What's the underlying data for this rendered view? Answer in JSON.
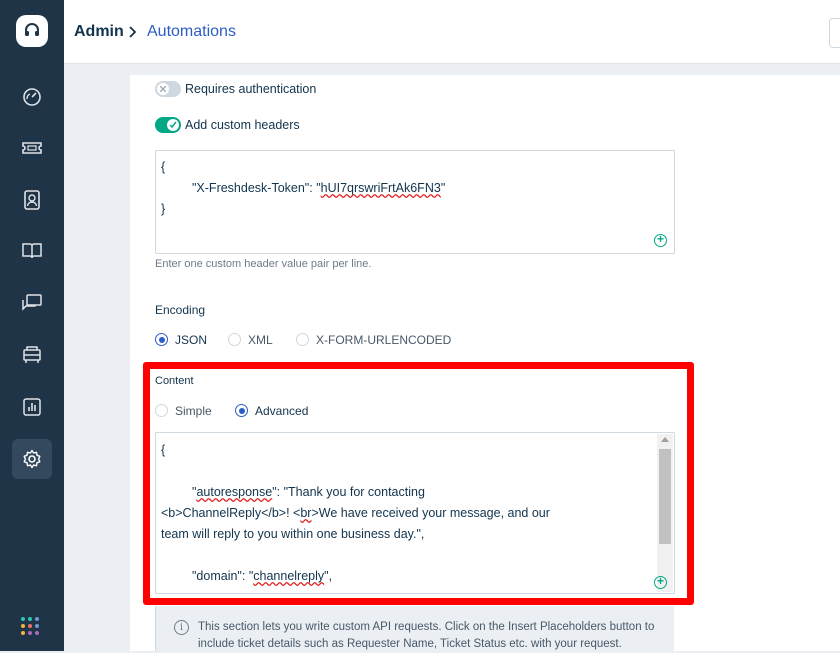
{
  "sidebar": {
    "logo_icon": "headset-icon",
    "items": [
      {
        "icon": "dashboard-icon"
      },
      {
        "icon": "ticket-icon"
      },
      {
        "icon": "contacts-icon"
      },
      {
        "icon": "solutions-book-icon"
      },
      {
        "icon": "discussions-icon"
      },
      {
        "icon": "assets-icon"
      },
      {
        "icon": "reports-icon"
      },
      {
        "icon": "gear-icon",
        "active": true
      }
    ],
    "apps_icon": "apps-grid-icon"
  },
  "breadcrumb": {
    "root": "Admin",
    "current": "Automations"
  },
  "auth": {
    "requires_auth_label": "Requires authentication",
    "requires_auth_on": false,
    "custom_headers_label": "Add custom headers",
    "custom_headers_on": true
  },
  "headers_box": {
    "line1": "{",
    "line2_key": "\"X-Freshdesk-Token\": \"",
    "line2_token": "hUI7qrswriFrtAk6FN3",
    "line2_end": "\"",
    "line3": "}",
    "hint": "Enter one custom header value pair per line."
  },
  "encoding": {
    "label": "Encoding",
    "options": [
      "JSON",
      "XML",
      "X-FORM-URLENCODED"
    ],
    "selected": "JSON"
  },
  "content": {
    "label": "Content",
    "modes": [
      "Simple",
      "Advanced"
    ],
    "selected": "Advanced",
    "code": {
      "open": "{",
      "l1_a": "\"",
      "l1_key": "autoresponse",
      "l1_b": "\": \"Thank you for contacting",
      "l2_a": "<b>ChannelReply</b>! <",
      "l2_br": "br",
      "l2_b": ">We have received your message, and our",
      "l3": "team will reply to you within one business day.\",",
      "l4_a": "\"domain\": \"",
      "l4_val": "channelreply",
      "l4_b": "\","
    }
  },
  "info": {
    "text": "This section lets you write custom API requests. Click on the Insert Placeholders button to include ticket details such as Requester Name, Ticket Status etc. with your request."
  },
  "colors": {
    "sidebar_bg": "#1f3447",
    "accent_green": "#00a886",
    "accent_blue": "#2c5cc5",
    "highlight_red": "#ff0000"
  }
}
